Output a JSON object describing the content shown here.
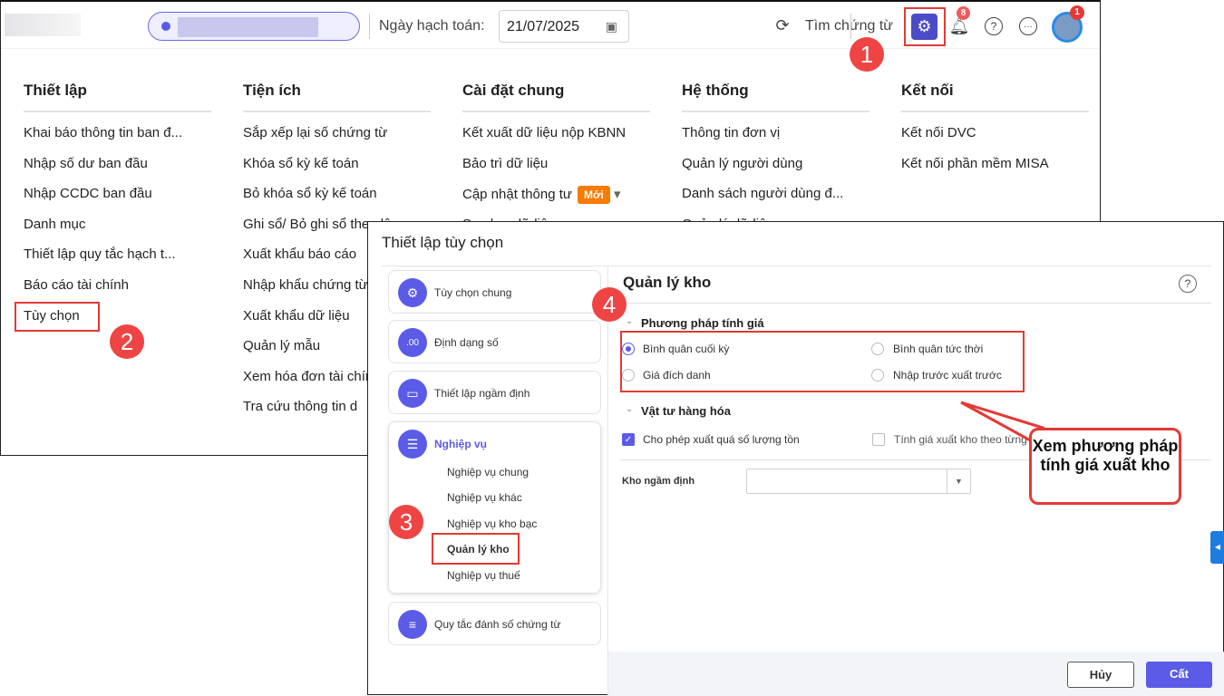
{
  "header": {
    "date_label": "Ngày hạch toán:",
    "date_value": "21/07/2025",
    "search_label": "Tìm chứng từ",
    "notif_count": "8",
    "avatar_badge": "1"
  },
  "menu": {
    "columns": [
      {
        "title": "Thiết lập",
        "items": [
          "Khai báo thông tin ban đ...",
          "Nhập số dư ban đầu",
          "Nhập CCDC ban đầu",
          "Danh mục",
          "Thiết lập quy tắc hạch t...",
          "Báo cáo tài chính",
          "Tùy chọn"
        ]
      },
      {
        "title": "Tiện ích",
        "items": [
          "Sắp xếp lại số chứng từ",
          "Khóa sổ kỳ kế toán",
          "Bỏ khóa sổ kỳ kế toán",
          "Ghi sổ/ Bỏ ghi sổ theo lô",
          "Xuất khẩu báo cáo",
          "Nhập khẩu chứng từ",
          "Xuất khẩu dữ liệu",
          "Quản lý mẫu",
          "Xem hóa đơn tài chính",
          "Tra cứu thông tin d"
        ]
      },
      {
        "title": "Cài đặt chung",
        "items": [
          "Kết xuất dữ liệu nộp KBNN",
          "Bảo trì dữ liệu",
          "Cập nhật thông tư",
          "Sao lưu dữ liệu"
        ],
        "new_badge": "Mới"
      },
      {
        "title": "Hệ thống",
        "items": [
          "Thông tin đơn vị",
          "Quản lý người dùng",
          "Danh sách người dùng đ...",
          "Quản lý dữ liệu"
        ]
      },
      {
        "title": "Kết nối",
        "items": [
          "Kết nối DVC",
          "Kết nối phần mềm MISA"
        ]
      }
    ]
  },
  "steps": [
    "1",
    "2",
    "3",
    "4"
  ],
  "dialog": {
    "title": "Thiết lập tùy chọn",
    "nav": {
      "general": "Tùy chọn chung",
      "number_format": "Định dạng số",
      "number_icon": ".00",
      "defaults": "Thiết lập ngầm định",
      "business": "Nghiệp vụ",
      "business_sub": [
        "Nghiệp vụ chung",
        "Nghiệp vụ khác",
        "Nghiệp vụ kho bạc",
        "Quản lý kho",
        "Nghiệp vụ thuế"
      ],
      "numbering": "Quy tắc đánh số chứng từ"
    },
    "panel": {
      "title": "Quản lý kho",
      "section1": "Phương pháp tính giá",
      "methods": [
        "Bình quân cuối kỳ",
        "Bình quân tức thời",
        "Giá đích danh",
        "Nhập trước xuất trước"
      ],
      "selected_method": "Bình quân cuối kỳ",
      "section2": "Vật tư hàng hóa",
      "check1": "Cho phép xuất quá số lượng tồn",
      "check1_checked": true,
      "check2": "Tính giá xuất kho theo từng",
      "check2_checked": false,
      "default_warehouse_label": "Kho ngầm định",
      "default_warehouse_value": ""
    },
    "cancel": "Hủy",
    "save": "Cất"
  },
  "callout": "Xem phương pháp tính giá xuất kho",
  "colors": {
    "accent": "#5b5be8",
    "highlight": "#e53935"
  }
}
